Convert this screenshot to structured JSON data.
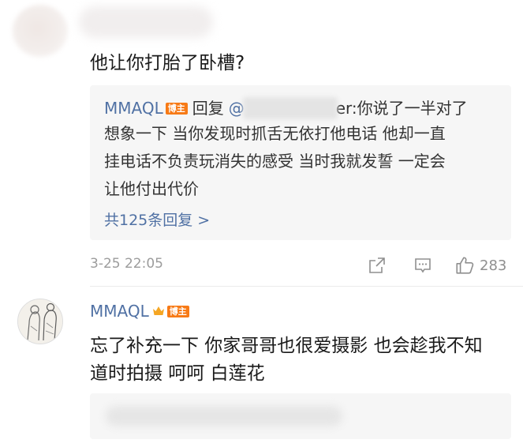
{
  "comment1": {
    "text": "他让你打胎了卧槽?"
  },
  "reply": {
    "author": "MMAQL",
    "badge": "博主",
    "reply_word": "回复",
    "mention_prefix": "@",
    "mention_suffix": "er:你说了一半对了",
    "line2": "想象一下 当你发现时抓舌无依打他电话 他却一直",
    "line3": "挂电话不负责玩消失的感受 当时我就发誓 一定会",
    "line4": "让他付出代价",
    "more_replies": "共125条回复 >"
  },
  "meta": {
    "timestamp": "3-25 22:05",
    "like_count": "283",
    "icons": [
      "share-icon",
      "comment-icon",
      "like-icon"
    ]
  },
  "comment2": {
    "author": "MMAQL",
    "badge": "博主",
    "line1": "忘了补充一下 你家哥哥也很爱摄影 也会趁我不知",
    "line2": "道时拍摄 呵呵 白莲花"
  },
  "colors": {
    "link": "#5071a4",
    "badge": "#f77a16",
    "meta": "#9c9c9c",
    "reply_bg": "#f6f6f6"
  }
}
